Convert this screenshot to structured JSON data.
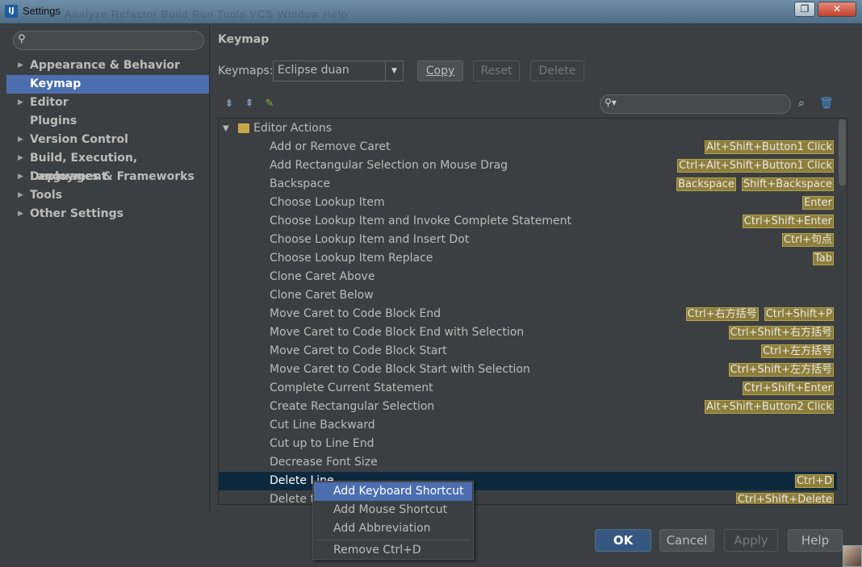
{
  "window": {
    "title": "Settings",
    "ghost_text": "Analyze  Refactor  Build  Run  Tools  VCS  Window  Help",
    "restore_icon": "restore-icon",
    "close_icon": "close-icon"
  },
  "sidebar": {
    "search": {
      "placeholder": "",
      "icon": "search-icon"
    },
    "items": [
      {
        "label": "Appearance & Behavior",
        "expandable": true
      },
      {
        "label": "Keymap",
        "expandable": false,
        "selected": true
      },
      {
        "label": "Editor",
        "expandable": true
      },
      {
        "label": "Plugins",
        "expandable": false
      },
      {
        "label": "Version Control",
        "expandable": true
      },
      {
        "label": "Build, Execution, Deployment",
        "expandable": true
      },
      {
        "label": "Languages & Frameworks",
        "expandable": true
      },
      {
        "label": "Tools",
        "expandable": true
      },
      {
        "label": "Other Settings",
        "expandable": true
      }
    ]
  },
  "main": {
    "title": "Keymap",
    "keymaps_label": "Keymaps:",
    "keymap_value": "Eclipse duan",
    "buttons": {
      "copy": "Copy",
      "reset": "Reset",
      "delete": "Delete"
    },
    "filter": {
      "placeholder": ""
    },
    "tree": {
      "group": "Editor Actions",
      "rows": [
        {
          "name": "Add or Remove Caret",
          "shortcuts": [
            "Alt+Shift+Button1 Click"
          ]
        },
        {
          "name": "Add Rectangular Selection on Mouse Drag",
          "shortcuts": [
            "Ctrl+Alt+Shift+Button1 Click"
          ]
        },
        {
          "name": "Backspace",
          "shortcuts": [
            "Backspace",
            "Shift+Backspace"
          ]
        },
        {
          "name": "Choose Lookup Item",
          "shortcuts": [
            "Enter"
          ]
        },
        {
          "name": "Choose Lookup Item and Invoke Complete Statement",
          "shortcuts": [
            "Ctrl+Shift+Enter"
          ]
        },
        {
          "name": "Choose Lookup Item and Insert Dot",
          "shortcuts": [
            "Ctrl+句点"
          ]
        },
        {
          "name": "Choose Lookup Item Replace",
          "shortcuts": [
            "Tab"
          ]
        },
        {
          "name": "Clone Caret Above",
          "shortcuts": []
        },
        {
          "name": "Clone Caret Below",
          "shortcuts": []
        },
        {
          "name": "Move Caret to Code Block End",
          "shortcuts": [
            "Ctrl+右方括号",
            "Ctrl+Shift+P"
          ]
        },
        {
          "name": "Move Caret to Code Block End with Selection",
          "shortcuts": [
            "Ctrl+Shift+右方括号"
          ]
        },
        {
          "name": "Move Caret to Code Block Start",
          "shortcuts": [
            "Ctrl+左方括号"
          ]
        },
        {
          "name": "Move Caret to Code Block Start with Selection",
          "shortcuts": [
            "Ctrl+Shift+左方括号"
          ]
        },
        {
          "name": "Complete Current Statement",
          "shortcuts": [
            "Ctrl+Shift+Enter"
          ]
        },
        {
          "name": "Create Rectangular Selection",
          "shortcuts": [
            "Alt+Shift+Button2 Click"
          ]
        },
        {
          "name": "Cut Line Backward",
          "shortcuts": []
        },
        {
          "name": "Cut up to Line End",
          "shortcuts": []
        },
        {
          "name": "Decrease Font Size",
          "shortcuts": []
        },
        {
          "name": "Delete Line",
          "shortcuts": [
            "Ctrl+D"
          ],
          "selected": true
        },
        {
          "name": "Delete t",
          "shortcuts": [
            "Ctrl+Shift+Delete"
          ]
        }
      ]
    }
  },
  "context_menu": {
    "items": [
      "Add Keyboard Shortcut",
      "Add Mouse Shortcut",
      "Add Abbreviation"
    ],
    "remove": "Remove Ctrl+D"
  },
  "footer": {
    "ok": "OK",
    "cancel": "Cancel",
    "apply": "Apply",
    "help": "Help"
  },
  "colors": {
    "selection": "#4b6eaf",
    "shortcut_bg": "#8d7e3a",
    "tree_selection": "#0d293e"
  }
}
